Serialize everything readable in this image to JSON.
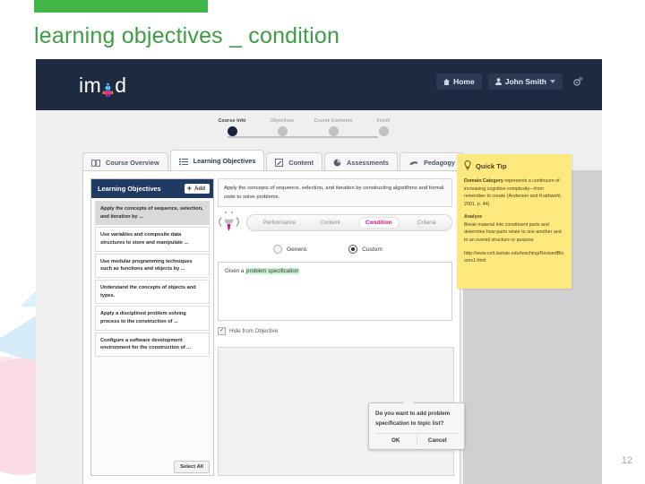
{
  "slide": {
    "title": "learning objectives _ condition",
    "page_number": "12",
    "accent_green": "#42b549",
    "title_color": "#3e9c46"
  },
  "app": {
    "navbar": {
      "brand": "im d",
      "brand_prefix": "im",
      "brand_suffix": "d",
      "home_label": "Home",
      "user_label": "John Smith",
      "gear_icon": "gear-icon"
    },
    "steps": [
      {
        "label": "Course Info",
        "active": true
      },
      {
        "label": "Objectives",
        "active": false
      },
      {
        "label": "Course Elements",
        "active": false
      },
      {
        "label": "Finish",
        "active": false
      }
    ],
    "tabs": [
      {
        "label": "Course Overview",
        "icon": "book-icon",
        "active": false
      },
      {
        "label": "Learning Objectives",
        "icon": "list-icon",
        "active": true
      },
      {
        "label": "Content",
        "icon": "pencil-square-icon",
        "active": false
      },
      {
        "label": "Assessments",
        "icon": "pie-chart-icon",
        "active": false
      },
      {
        "label": "Pedagogy",
        "icon": "hand-icon",
        "active": false
      }
    ],
    "objectives_panel": {
      "title": "Learning Objectives",
      "add_label": "Add",
      "select_all_label": "Select All",
      "items": [
        {
          "text": "Apply the concepts of sequence, selection, and iteration by ...",
          "selected": true
        },
        {
          "text": "Use variables and composite data structures to store and manipulate ...",
          "selected": false
        },
        {
          "text": "Use modular programming techniques such as functions and objects by ...",
          "selected": false
        },
        {
          "text": "Understand the concepts of objects and types.",
          "selected": false
        },
        {
          "text": "Apply a disciplined problem solving process to the construction of ...",
          "selected": false
        },
        {
          "text": "Configure a software development environment for the construction of ...",
          "selected": false
        }
      ]
    },
    "detail": {
      "objective_text": "Apply the concepts of sequence, selection, and iteration by constructing algorithms and formal code to solve problems.",
      "megaphone_icon": "megaphone-icon",
      "subtabs": [
        {
          "label": "Performance",
          "active": false
        },
        {
          "label": "Content",
          "active": false
        },
        {
          "label": "Condition",
          "active": true
        },
        {
          "label": "Criteria",
          "active": false
        }
      ],
      "active_subtab_color": "#d2147a",
      "radios": [
        {
          "label": "Generic",
          "selected": false
        },
        {
          "label": "Custom",
          "selected": true
        }
      ],
      "condition_text_prefix": "Given a ",
      "condition_text_highlight": "problem specification",
      "highlight_color": "#c9f3cf",
      "hide_from_objective_label": "Hide from Objective",
      "hide_from_objective_checked": true
    },
    "dialog": {
      "message": "Do you want to add problem specification to topic list?",
      "ok_label": "OK",
      "cancel_label": "Cancel"
    },
    "quick_tip": {
      "title": "Quick Tip",
      "icon": "lightbulb-icon",
      "background": "#ffe97f",
      "paragraph_1_lead": "Domain Category",
      "paragraph_1": " represents a continuum of increasing cognitive complexity—from remember to create (Anderson and Krathwohl, 2001, p. 44).",
      "paragraph_2_lead": "Analyze",
      "paragraph_2": "Break material into constituent parts and determine how parts relate to one another and to an overall structure or purpose",
      "link": "http://www.celt.iastate.edu/teaching/RevisedBlooms1.html"
    }
  }
}
